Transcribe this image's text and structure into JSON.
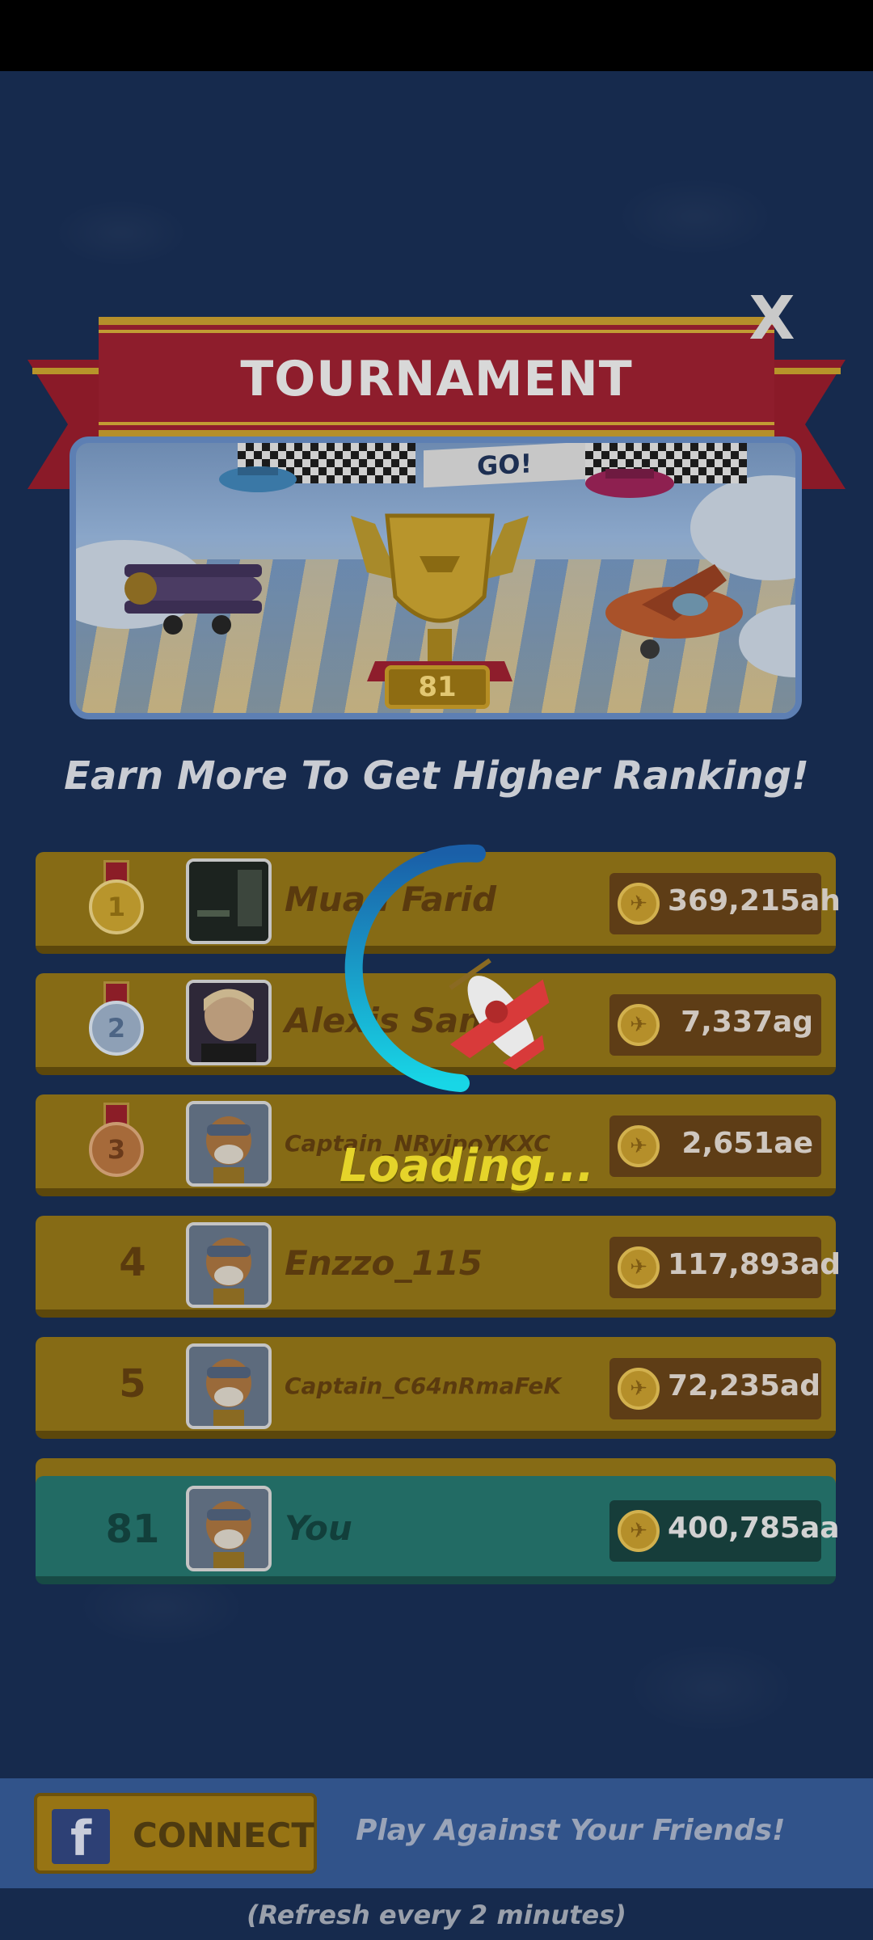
{
  "header": {
    "title": "TOURNAMENT",
    "close_label": "X"
  },
  "banner": {
    "flag_text": "GO!",
    "trophy_level": "81"
  },
  "subtitle": "Earn More To Get Higher Ranking!",
  "leaderboard": [
    {
      "rank": "1",
      "name": "Muad Farid",
      "score": "369,215ah",
      "medal": "gold"
    },
    {
      "rank": "2",
      "name": "Alexis Sanc",
      "score": "7,337ag",
      "medal": "silver"
    },
    {
      "rank": "3",
      "name": "Captain_NRyjpoYKXC",
      "score": "2,651ae",
      "medal": "bronze"
    },
    {
      "rank": "4",
      "name": "Enzzo_115",
      "score": "117,893ad"
    },
    {
      "rank": "5",
      "name": "Captain_C64nRmaFeK",
      "score": "72,235ad"
    }
  ],
  "player": {
    "rank": "81",
    "name": "You",
    "score": "400,785aa"
  },
  "loading_text": "Loading...",
  "footer": {
    "fb_logo": "f",
    "connect_label": "CONNECT",
    "invite_text": "Play Against Your Friends!",
    "refresh_note": "(Refresh every 2 minutes)"
  },
  "colors": {
    "background": "#162a4d",
    "ribbon": "#8e1d2c",
    "row": "#866b15",
    "player_row": "#226b64",
    "loading": "#e5d42a",
    "bottom_bar": "#31538a"
  },
  "icons": {
    "coin": "coin-icon",
    "close": "close-icon",
    "facebook": "facebook-icon",
    "spinner": "airplane-spinner-icon"
  }
}
